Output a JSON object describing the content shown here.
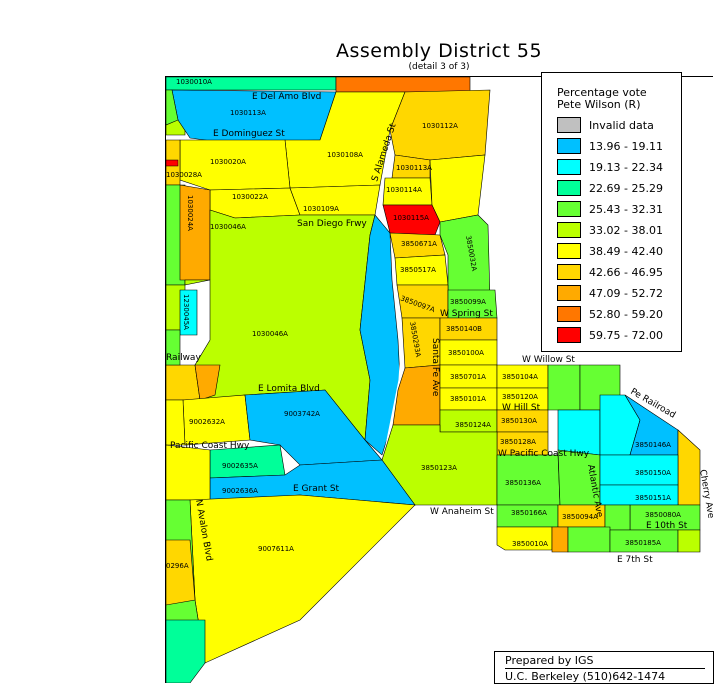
{
  "title": "Assembly District 55",
  "subtitle": "(detail 3 of 3)",
  "legend": {
    "title_line1": "Percentage vote",
    "title_line2": "Pete Wilson (R)",
    "items": [
      {
        "label": "Invalid data",
        "color": "#c0c0c0"
      },
      {
        "label": "13.96 - 19.11",
        "color": "#00c0ff"
      },
      {
        "label": "19.13 - 22.34",
        "color": "#00ffff"
      },
      {
        "label": "22.69 - 25.29",
        "color": "#00ff99"
      },
      {
        "label": "25.43 - 32.31",
        "color": "#66ff33"
      },
      {
        "label": "33.02 - 38.01",
        "color": "#bbff00"
      },
      {
        "label": "38.49 - 42.40",
        "color": "#ffff00"
      },
      {
        "label": "42.66 - 46.95",
        "color": "#ffd700"
      },
      {
        "label": "47.09 - 52.72",
        "color": "#ffaa00"
      },
      {
        "label": "52.80 - 59.20",
        "color": "#ff7700"
      },
      {
        "label": "59.75 - 72.00",
        "color": "#ff0000"
      }
    ]
  },
  "credit": {
    "line1": "Prepared by IGS",
    "line2": "U.C. Berkeley (510)642-1474"
  },
  "streets": {
    "del_amo": "E Del Amo Blvd",
    "dominguez": "E Dominguez St",
    "alameda": "S Alameda St",
    "san_diego": "San Diego Frwy",
    "spring": "W Spring St",
    "willow": "W Willow St",
    "santa_fe": "Santa Fe Ave",
    "pe_railroad": "Pe Railroad",
    "hill": "W Hill St",
    "pch_w": "W Pacific Coast Hwy",
    "pch": "Pacific Coast Hwy",
    "lomita": "E Lomita Blvd",
    "grant": "E Grant St",
    "anaheim": "W Anaheim St",
    "tenth": "E 10th St",
    "seventh": "E 7th St",
    "cherry": "Cherry Ave",
    "atlantic": "Atlantic Ave",
    "avalon": "N Avalon Blvd",
    "railway": "Railway"
  },
  "precincts": {
    "p1030010A": "1030010A",
    "p1030113A": "1030113A",
    "p1030112A": "1030112A",
    "p1030020A": "1030020A",
    "p1030108A": "1030108A",
    "p1030113A_b": "1030113A",
    "p1030028A": "1030028A",
    "p1030022A": "1030022A",
    "p1030109A": "1030109A",
    "p1030114A": "1030114A",
    "p1030115A": "1030115A",
    "p1030024A": "1030024A",
    "p1030046A": "1030046A",
    "p1030046A_b": "1030046A",
    "p3850671A": "3850671A",
    "p3850517A": "3850517A",
    "p3850097A": "3850097A",
    "p3850099A": "3850099A",
    "p3850140B": "3850140B",
    "p3850100A": "3850100A",
    "p3850101A": "3850101A",
    "p3850104A": "3850104A",
    "p3850120A": "3850120A",
    "p3850130A": "3850130A",
    "p3850124A": "3850124A",
    "p3850128A": "3850128A",
    "p3850123A": "3850123A",
    "p3850136A": "3850136A",
    "p3850146A": "3850146A",
    "p3850150A": "3850150A",
    "p3850151A": "3850151A",
    "p3850166A": "3850166A",
    "p3850080A": "3850080A",
    "p3850185A": "3850185A",
    "p3850010A": "3850010A",
    "p3850701A": "3850701A",
    "p9002632A": "9002632A",
    "p9003742A": "9003742A",
    "p9002635A": "9002635A",
    "p9002636A": "9002636A",
    "p9007611A": "9007611A",
    "p1230045A": "1230045A",
    "p3850293A": "3850293A",
    "p3850032A": "3850032A",
    "p3850094A": "3850094A",
    "p0296A": "0296A"
  }
}
